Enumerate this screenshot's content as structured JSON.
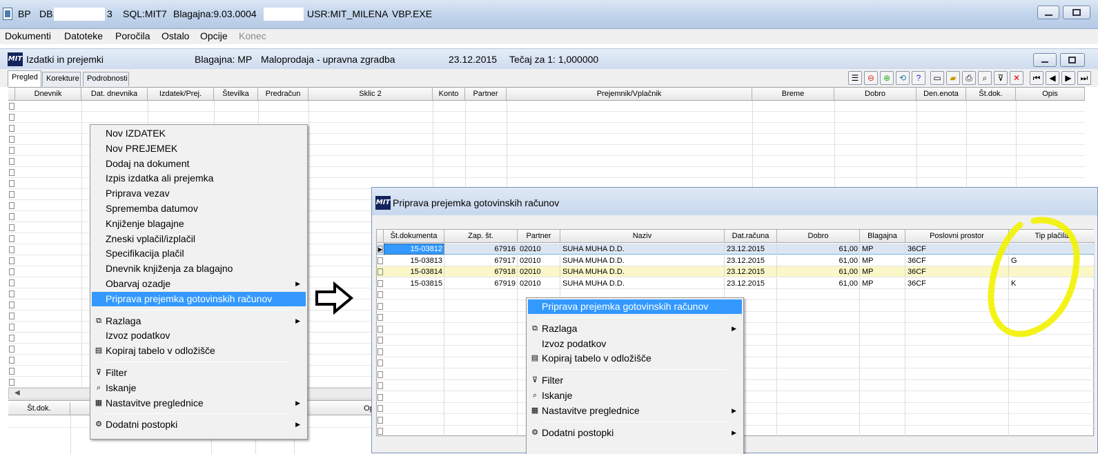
{
  "app": {
    "title_parts": [
      "BP",
      "DB:",
      "3",
      "SQL:MIT7",
      "Blagajna:9.03.0004",
      "USR:MIT_MILENA",
      "VBP.EXE"
    ]
  },
  "menubar": [
    "Dokumenti",
    "Datoteke",
    "Poročila",
    "Ostalo",
    "Opcije",
    "Konec"
  ],
  "window": {
    "logo": "MIT",
    "title": "Izdatki in prejemki",
    "blagajna": "Blagajna: MP",
    "location": "Maloprodaja - upravna zgradba",
    "date": "23.12.2015",
    "rate": "Tečaj za 1: 1,000000"
  },
  "tabs": [
    "Pregled",
    "Korekture",
    "Podrobnosti"
  ],
  "main_columns": [
    "Dnevnik",
    "Dat. dnevnika",
    "Izdatek/Prej.",
    "Številka",
    "Predračun",
    "Sklic 2",
    "Konto",
    "Partner",
    "Prejemnik/Vplačnik",
    "Breme",
    "Dobro",
    "Den.enota",
    "Št.dok.",
    "Opis"
  ],
  "lower_columns": [
    "Št.dok.",
    "Op"
  ],
  "context_menu": {
    "items": [
      {
        "label": "Nov IZDATEK",
        "icon": "",
        "submenu": false
      },
      {
        "label": "Nov PREJEMEK",
        "icon": "",
        "submenu": false
      },
      {
        "label": "Dodaj na dokument",
        "icon": "",
        "submenu": false
      },
      {
        "label": "Izpis izdatka ali prejemka",
        "icon": "",
        "submenu": false
      },
      {
        "label": "Priprava vezav",
        "icon": "",
        "submenu": false
      },
      {
        "label": "Sprememba datumov",
        "icon": "",
        "submenu": false
      },
      {
        "label": "Knjiženje blagajne",
        "icon": "",
        "submenu": false
      },
      {
        "label": "Zneski vplačil/izplačil",
        "icon": "",
        "submenu": false
      },
      {
        "label": "Specifikacija plačil",
        "icon": "",
        "submenu": false
      },
      {
        "label": "Dnevnik knjiženja za blagajno",
        "icon": "",
        "submenu": false
      },
      {
        "label": "Obarvaj ozadje",
        "icon": "",
        "submenu": true
      },
      {
        "label": "Priprava prejemka gotovinskih računov",
        "icon": "",
        "submenu": false,
        "selected": true
      },
      {
        "label": "Razlaga",
        "icon": "help-icon",
        "submenu": true
      },
      {
        "label": "Izvoz podatkov",
        "icon": "",
        "submenu": false
      },
      {
        "label": "Kopiraj tabelo v odložišče",
        "icon": "clipboard-icon",
        "submenu": false
      },
      {
        "label": "Filter",
        "icon": "filter-icon",
        "submenu": false
      },
      {
        "label": "Iskanje",
        "icon": "search-icon",
        "submenu": false
      },
      {
        "label": "Nastavitve preglednice",
        "icon": "settings-icon",
        "submenu": true
      },
      {
        "label": "Dodatni postopki",
        "icon": "tools-icon",
        "submenu": true
      }
    ]
  },
  "dialog": {
    "title": "Priprava prejemka gotovinskih računov",
    "columns": [
      "Št.dokumenta",
      "Zap. št.",
      "Partner",
      "Naziv",
      "Dat.računa",
      "Dobro",
      "Blagajna",
      "Poslovni prostor",
      "Tip plačila"
    ],
    "rows": [
      [
        "15-03812",
        "67916",
        "02010",
        "SUHA MUHA D.D.",
        "23.12.2015",
        "61,00",
        "MP",
        "36CF",
        ""
      ],
      [
        "15-03813",
        "67917",
        "02010",
        "SUHA MUHA D.D.",
        "23.12.2015",
        "61,00",
        "MP",
        "36CF",
        "G"
      ],
      [
        "15-03814",
        "67918",
        "02010",
        "SUHA MUHA D.D.",
        "23.12.2015",
        "61,00",
        "MP",
        "36CF",
        ""
      ],
      [
        "15-03815",
        "67919",
        "02010",
        "SUHA MUHA D.D.",
        "23.12.2015",
        "61,00",
        "MP",
        "36CF",
        "K"
      ]
    ],
    "context_menu": [
      {
        "label": "Priprava prejemka gotovinskih računov",
        "icon": "",
        "submenu": false,
        "selected": true
      },
      {
        "label": "Razlaga",
        "icon": "help-icon",
        "submenu": true
      },
      {
        "label": "Izvoz podatkov",
        "icon": "",
        "submenu": false
      },
      {
        "label": "Kopiraj tabelo v odložišče",
        "icon": "clipboard-icon",
        "submenu": false
      },
      {
        "label": "Filter",
        "icon": "filter-icon",
        "submenu": false
      },
      {
        "label": "Iskanje",
        "icon": "search-icon",
        "submenu": false
      },
      {
        "label": "Nastavitve preglednice",
        "icon": "settings-icon",
        "submenu": true
      },
      {
        "label": "Dodatni postopki",
        "icon": "tools-icon",
        "submenu": true
      }
    ]
  },
  "colors": {
    "selection": "#3399ff",
    "highlight_row": "#fbf7c8",
    "annotation": "#f5f500",
    "title_gradient": "#c3d5ec"
  }
}
